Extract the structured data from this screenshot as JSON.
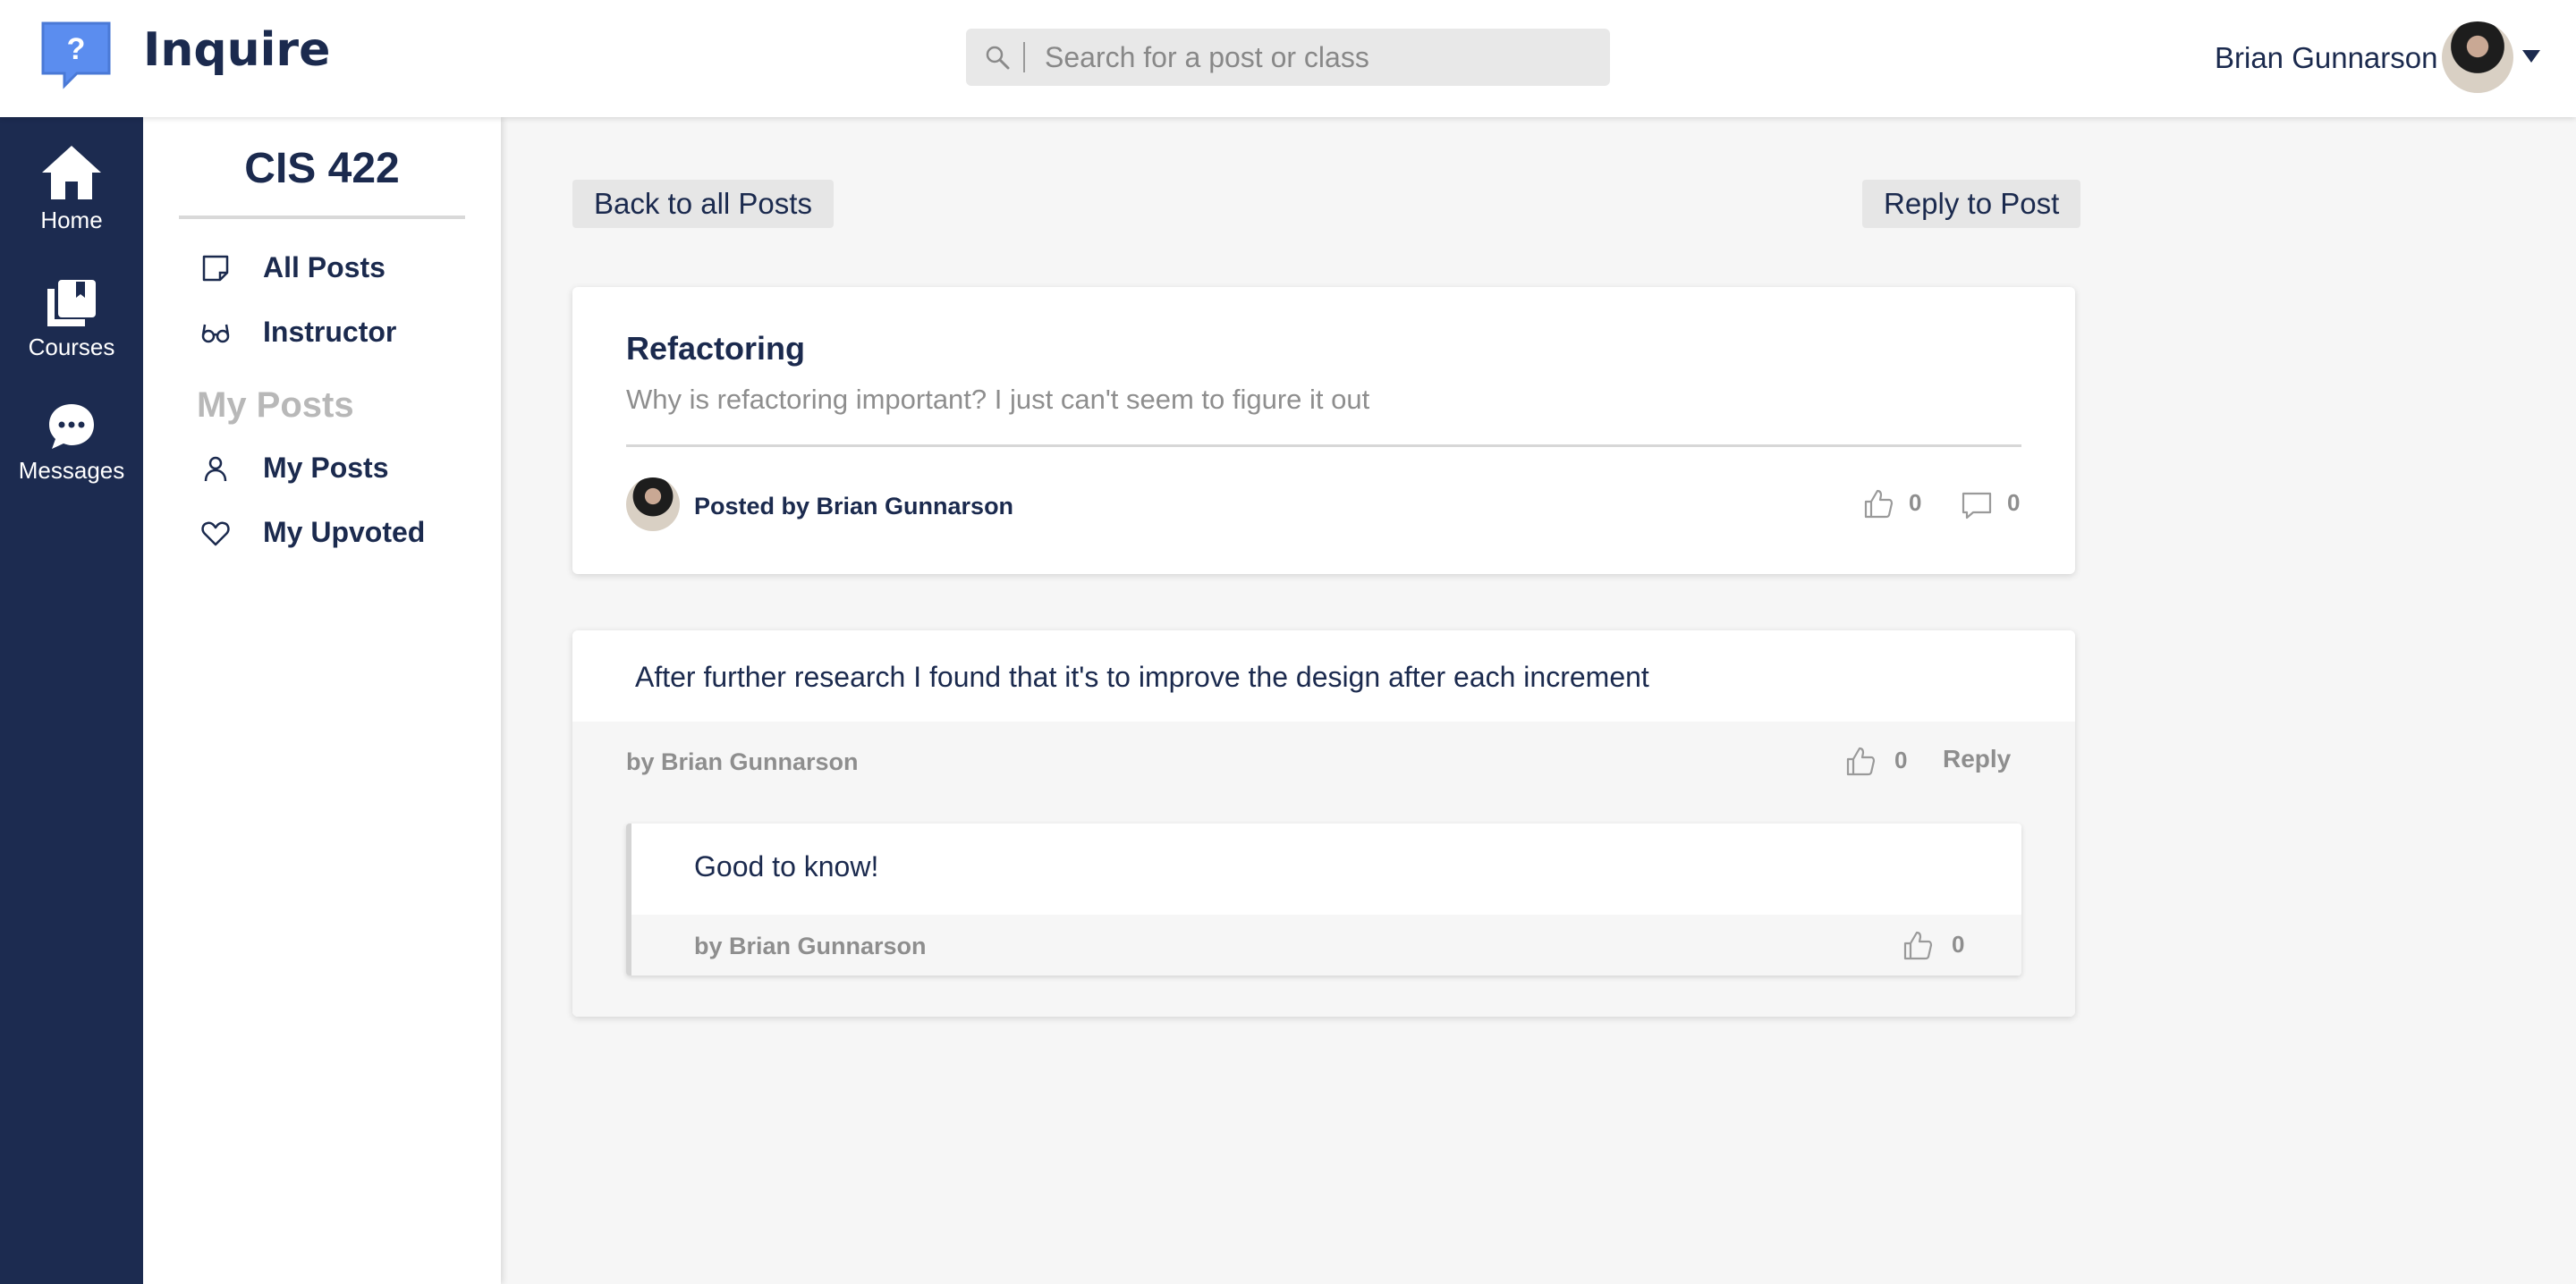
{
  "header": {
    "app_name": "Inquire",
    "logo_glyph": "?",
    "search": {
      "placeholder": "Search for a post or class",
      "value": ""
    },
    "user_name": "Brian Gunnarson",
    "brand_color": "#5b8def"
  },
  "rail": {
    "items": [
      {
        "label": "Home",
        "icon": "home-icon"
      },
      {
        "label": "Courses",
        "icon": "courses-icon"
      },
      {
        "label": "Messages",
        "icon": "messages-icon"
      }
    ]
  },
  "sidebar": {
    "course": "CIS 422",
    "items": [
      {
        "label": "All Posts",
        "icon": "note-icon"
      },
      {
        "label": "Instructor",
        "icon": "glasses-icon"
      }
    ],
    "section_label": "My Posts",
    "my_items": [
      {
        "label": "My Posts",
        "icon": "person-icon"
      },
      {
        "label": "My Upvoted",
        "icon": "heart-icon"
      }
    ]
  },
  "main": {
    "back_button": "Back to all Posts",
    "reply_button": "Reply to Post",
    "post": {
      "title": "Refactoring",
      "body": "Why is refactoring important? I just can't seem to figure it out",
      "posted_by": "Posted by Brian Gunnarson",
      "likes": "0",
      "comments": "0"
    },
    "reply": {
      "text": "After further research I found that it's to improve the design after each increment",
      "by": "by Brian Gunnarson",
      "likes": "0",
      "reply_link": "Reply",
      "nested": {
        "text": "Good to know!",
        "by": "by Brian Gunnarson",
        "likes": "0"
      }
    }
  }
}
